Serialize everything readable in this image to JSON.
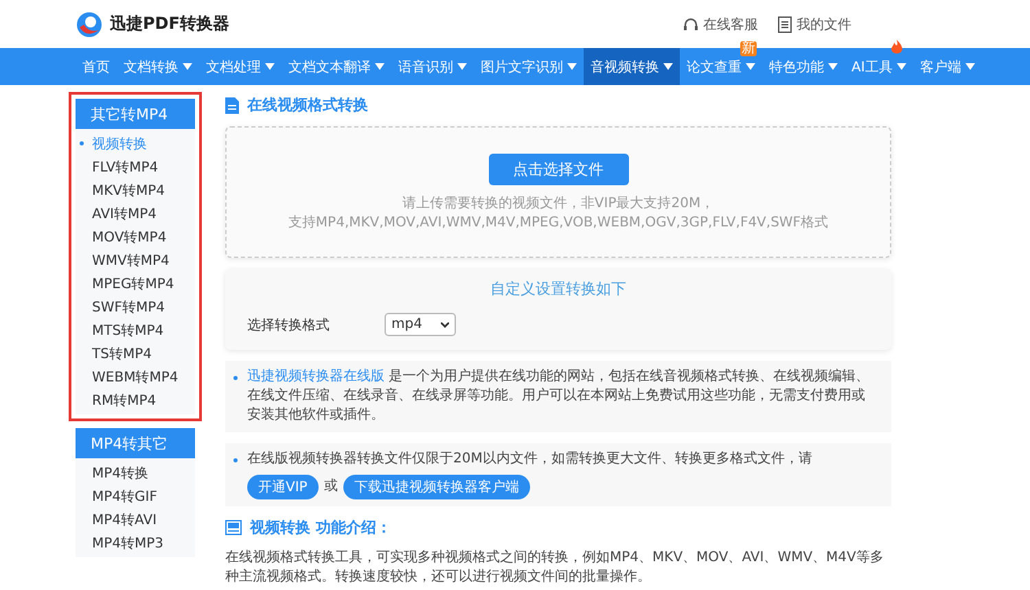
{
  "header": {
    "brand": "迅捷PDF转换器",
    "links": [
      {
        "kind": "support",
        "label": "在线客服"
      },
      {
        "kind": "files",
        "label": "我的文件"
      }
    ]
  },
  "nav": [
    {
      "label": "首页",
      "selected": false,
      "has_menu": false
    },
    {
      "label": "文档转换",
      "selected": false,
      "has_menu": true
    },
    {
      "label": "文档处理",
      "selected": false,
      "has_menu": true
    },
    {
      "label": "文档文本翻译",
      "selected": false,
      "has_menu": true
    },
    {
      "label": "语音识别",
      "selected": false,
      "has_menu": true
    },
    {
      "label": "图片文字识别",
      "selected": false,
      "has_menu": true
    },
    {
      "label": "音视频转换",
      "selected": true,
      "has_menu": true
    },
    {
      "label": "论文查重",
      "selected": false,
      "has_menu": true,
      "badge": {
        "kind": "text",
        "text": "新"
      }
    },
    {
      "label": "特色功能",
      "selected": false,
      "has_menu": true
    },
    {
      "label": "AI工具",
      "selected": false,
      "has_menu": true,
      "badge": {
        "kind": "fire"
      }
    },
    {
      "label": "客户端",
      "selected": false,
      "has_menu": true
    }
  ],
  "sidebar": [
    {
      "title": "其它转MP4",
      "highlighted": true,
      "items": [
        {
          "label": "视频转换",
          "selected": true
        },
        {
          "label": "FLV转MP4",
          "selected": false
        },
        {
          "label": "MKV转MP4",
          "selected": false
        },
        {
          "label": "AVI转MP4",
          "selected": false
        },
        {
          "label": "MOV转MP4",
          "selected": false
        },
        {
          "label": "WMV转MP4",
          "selected": false
        },
        {
          "label": "MPEG转MP4",
          "selected": false
        },
        {
          "label": "SWF转MP4",
          "selected": false
        },
        {
          "label": "MTS转MP4",
          "selected": false
        },
        {
          "label": "TS转MP4",
          "selected": false
        },
        {
          "label": "WEBM转MP4",
          "selected": false
        },
        {
          "label": "RM转MP4",
          "selected": false
        }
      ]
    },
    {
      "title": "MP4转其它",
      "highlighted": false,
      "items": [
        {
          "label": "MP4转换",
          "selected": false
        },
        {
          "label": "MP4转GIF",
          "selected": false
        },
        {
          "label": "MP4转AVI",
          "selected": false
        },
        {
          "label": "MP4转MP3",
          "selected": false
        }
      ]
    }
  ],
  "main": {
    "title": "在线视频格式转换",
    "upload": {
      "button": "点击选择文件",
      "hint_lines": [
        "请上传需要转换的视频文件，非VIP最大支持20M，",
        "支持MP4,MKV,MOV,AVI,WMV,M4V,MPEG,VOB,WEBM,OGV,3GP,FLV,F4V,SWF格式"
      ]
    },
    "settings": {
      "title": "自定义设置转换如下",
      "format_label": "选择转换格式",
      "format_value": "mp4"
    },
    "notes": [
      {
        "link": "迅捷视频转换器在线版",
        "text": " 是一个为用户提供在线功能的网站，包括在线音视频格式转换、在线视频编辑、在线文件压缩、在线录音、在线录屏等功能。用户可以在本网站上免费试用这些功能，无需支付费用或安装其他软件或插件。"
      },
      {
        "text": "在线版视频转换器转换文件仅限于20M以内文件，如需转换更大文件、转换更多格式文件，请",
        "vip_button": "开通VIP",
        "or": "或",
        "download_button": "下载迅捷视频转换器客户端"
      }
    ],
    "intro": {
      "title": "视频转换 功能介绍：",
      "text": "在线视频格式转换工具，可实现多种视频格式之间的转换，例如MP4、MKV、MOV、AVI、WMV、M4V等多种主流视频格式。转换速度较快，还可以进行视频文件间的批量操作。"
    }
  }
}
